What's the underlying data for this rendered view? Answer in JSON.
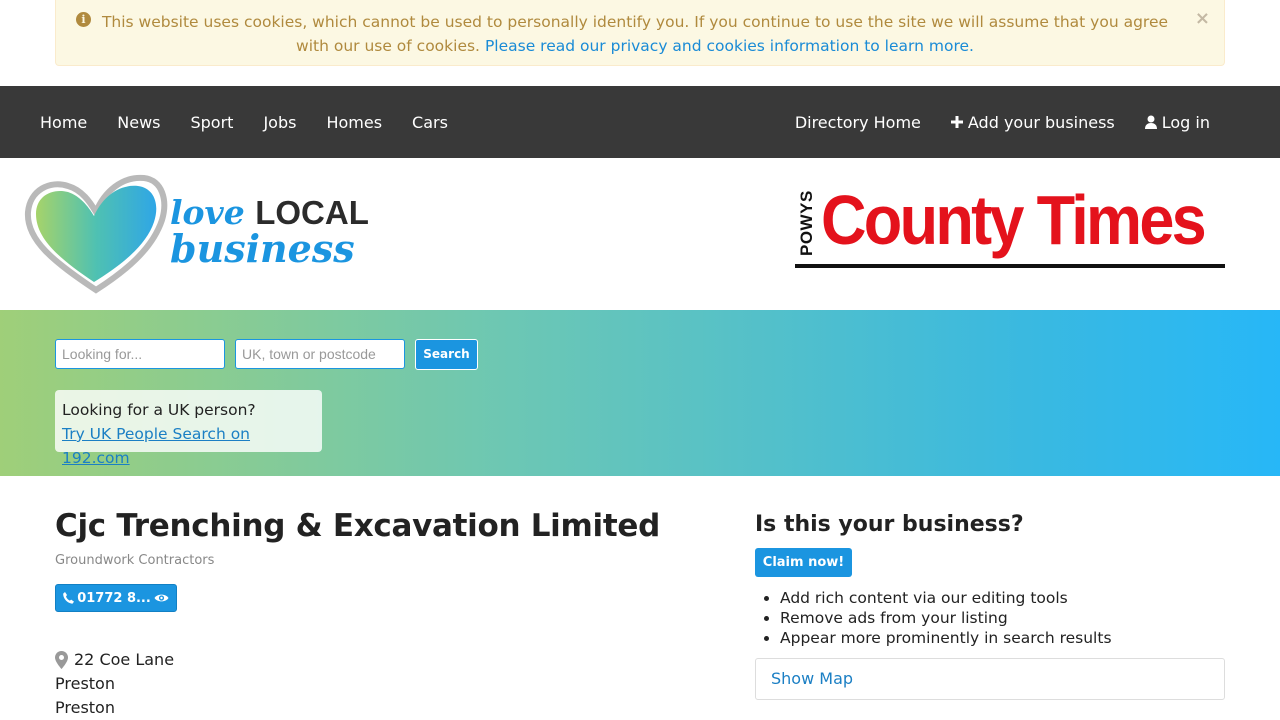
{
  "cookie": {
    "text": "This website uses cookies, which cannot be used to personally identify you. If you continue to use the site we will assume that you agree with our use of cookies.",
    "link_text": "Please read our privacy and cookies information to learn more.",
    "close": "×",
    "info": "i"
  },
  "nav": {
    "left": [
      "Home",
      "News",
      "Sport",
      "Jobs",
      "Homes",
      "Cars"
    ],
    "directory_home": "Directory Home",
    "add_business": "Add your business",
    "log_in": "Log in"
  },
  "logo_left": {
    "love": "love",
    "local": "LOCAL",
    "business": "business"
  },
  "logo_right": {
    "powys": "POWYS",
    "title": "County Times"
  },
  "search": {
    "looking_for_placeholder": "Looking for...",
    "location_placeholder": "UK, town or postcode",
    "button": "Search"
  },
  "people": {
    "question": "Looking for a UK person?",
    "link": "Try UK People Search on 192.com"
  },
  "business": {
    "name": "Cjc Trenching & Excavation Limited",
    "category": "Groundwork Contractors",
    "phone": "01772 8...",
    "address": [
      "22 Coe Lane",
      "Preston",
      "Preston"
    ]
  },
  "claim": {
    "heading": "Is this your business?",
    "button": "Claim now!",
    "benefits": [
      "Add rich content via our editing tools",
      "Remove ads from your listing",
      "Appear more prominently in search results"
    ],
    "show_map": "Show Map"
  }
}
